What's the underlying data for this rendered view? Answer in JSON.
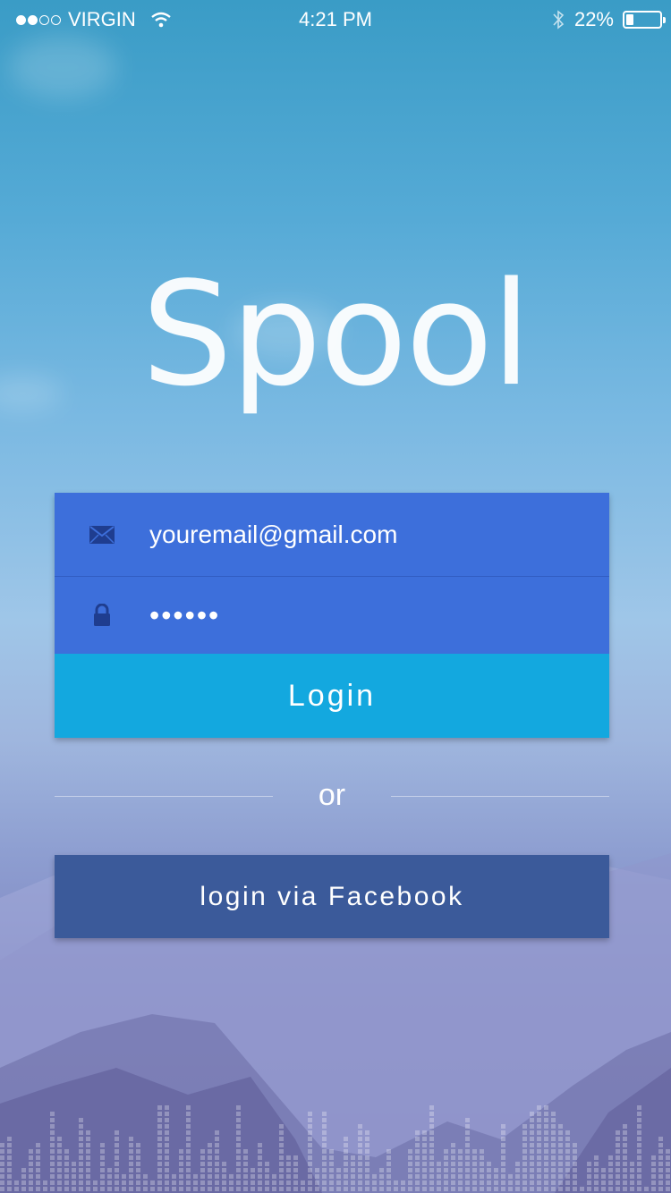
{
  "status_bar": {
    "carrier": "VIRGIN",
    "time": "4:21 PM",
    "battery": "22%",
    "battery_level": 0.22,
    "signal_bars": 2
  },
  "app": {
    "logo": "Spool"
  },
  "form": {
    "email_value": "youremail@gmail.com",
    "password_mask": "••••••",
    "login_label": "Login"
  },
  "divider": {
    "text": "or"
  },
  "facebook": {
    "label": "login via Facebook"
  },
  "colors": {
    "field_bg": "#3d6fdb",
    "login_bg": "#13a8df",
    "facebook_bg": "#3b5a9a"
  },
  "icons": {
    "email": "envelope-icon",
    "password": "lock-icon",
    "wifi": "wifi-icon",
    "bluetooth": "bluetooth-icon",
    "battery": "battery-icon"
  }
}
